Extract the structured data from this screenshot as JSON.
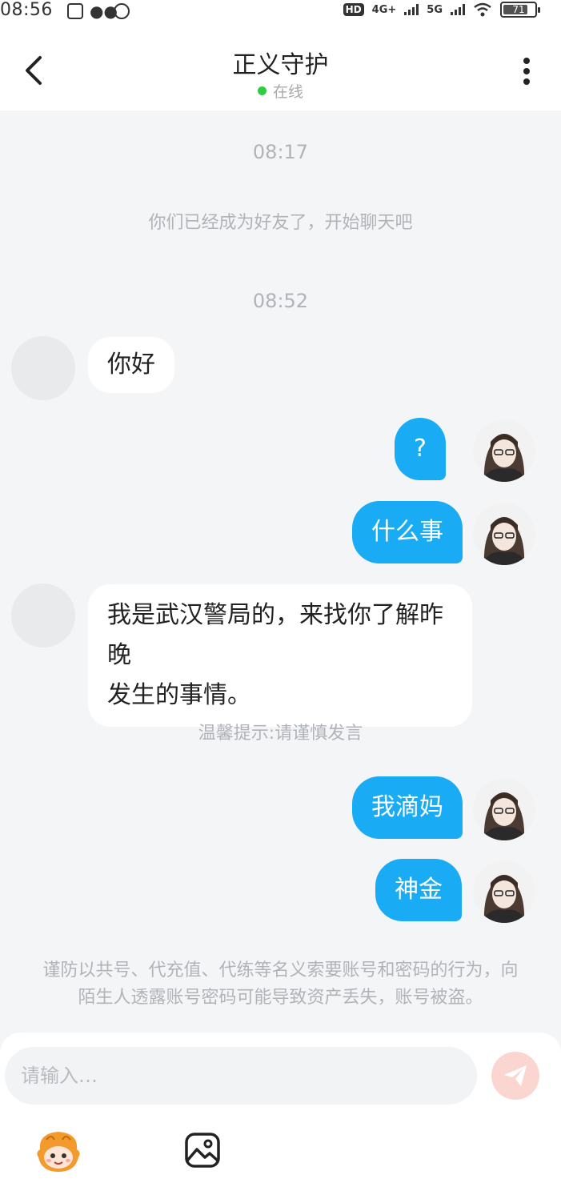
{
  "status_bar": {
    "time": "08:56",
    "hd": "HD",
    "net1": "4G+",
    "net2": "5G",
    "battery": "71"
  },
  "header": {
    "title": "正义守护",
    "status": "在线",
    "status_color": "#2ecc40"
  },
  "chat": {
    "time1": "08:17",
    "system_friend": "你们已经成为好友了，开始聊天吧",
    "time2": "08:52",
    "msg1": "你好",
    "msg2": "?",
    "msg3": "什么事",
    "msg4_line1": "我是武汉警局的，来找你了解昨晚",
    "msg4_line2": "发生的事情。",
    "tip": "温馨提示:请谨慎发言",
    "msg5": "我滴妈",
    "msg6": "神金",
    "warning_line1": "谨防以共号、代充值、代练等名义索要账号和密码的行为，向",
    "warning_line2": "陌生人透露账号密码可能导致资产丢失，账号被盗。"
  },
  "composer": {
    "placeholder": "请输入…",
    "send_icon": "send-icon",
    "emoji_icon": "emoji-icon",
    "image_icon": "image-icon"
  },
  "colors": {
    "accent": "#1aabf5",
    "background": "#f4f5f7",
    "send_disabled": "#fbd6d0"
  }
}
